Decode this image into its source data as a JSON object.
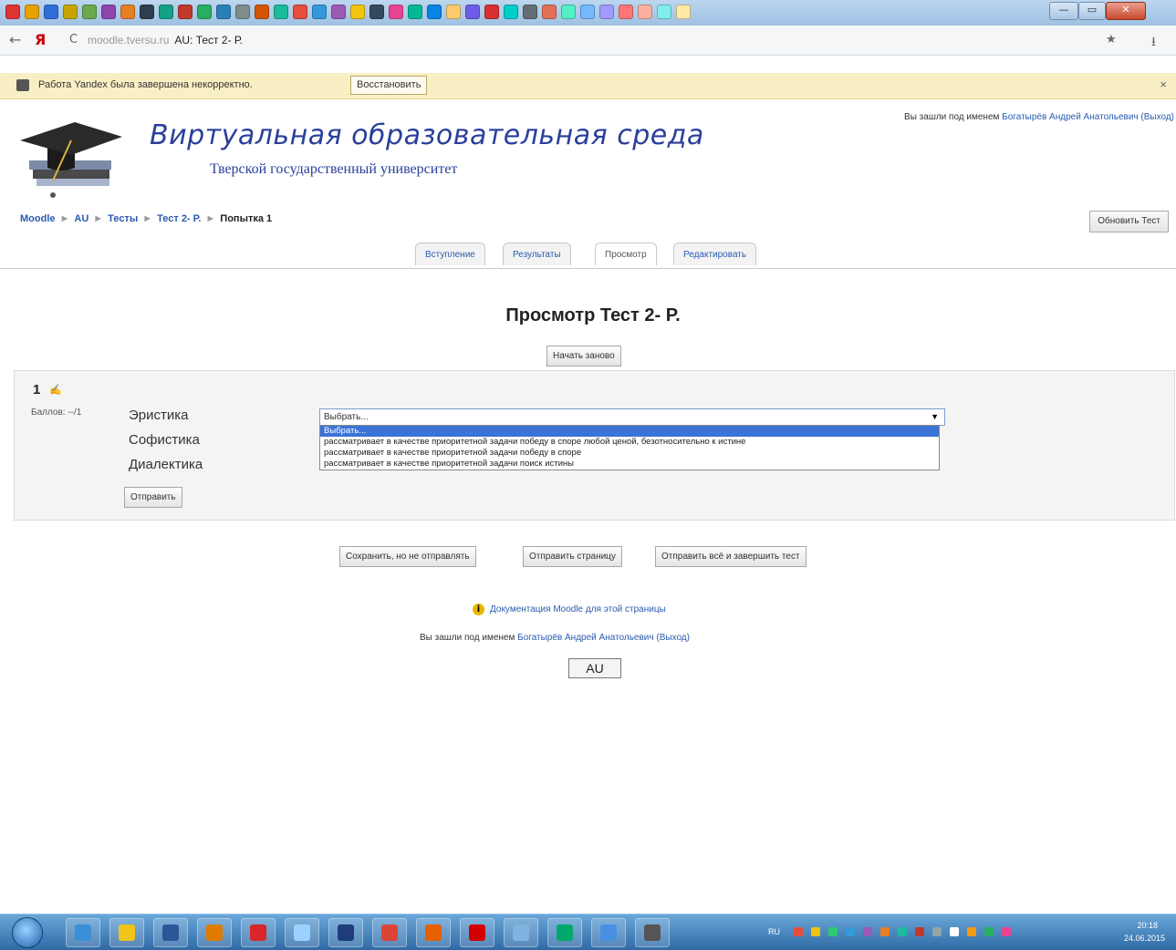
{
  "browser": {
    "url_host": "moodle.tversu.ru",
    "page_title": "AU: Тест 2- Р.",
    "notification": "Работа Yandex была завершена некорректно.",
    "restore_label": "Восстановить",
    "close_glyph": "×",
    "back_glyph": "←",
    "yandex_glyph": "Я",
    "reload_glyph": "C",
    "star_glyph": "★",
    "download_glyph": "⭳",
    "win_min": "—",
    "win_max": "▭",
    "win_close": "✕",
    "tab_icons": [
      "#d33",
      "#e8a000",
      "#2f6ed6",
      "#c9a400",
      "#6aa84f",
      "#8e44ad",
      "#e67e22",
      "#2c3e50",
      "#16a085",
      "#c0392b",
      "#27ae60",
      "#2980b9",
      "#7f8c8d",
      "#d35400",
      "#1abc9c",
      "#e74c3c",
      "#3498db",
      "#9b59b6",
      "#f1c40f",
      "#34495e",
      "#e84393",
      "#00b894",
      "#0984e3",
      "#fdcb6e",
      "#6c5ce7",
      "#d63031",
      "#00cec9",
      "#636e72",
      "#e17055",
      "#55efc4",
      "#74b9ff",
      "#a29bfe",
      "#ff7675",
      "#fab1a0",
      "#81ecec",
      "#ffeaa7"
    ]
  },
  "header": {
    "title": "Виртуальная образовательная среда",
    "subtitle": "Тверской государственный университет",
    "login_prefix": "Вы зашли под именем",
    "user_name": "Богатырёв Андрей Анатольевич",
    "logout": "(Выход)"
  },
  "breadcrumb": [
    "Moodle",
    "AU",
    "Тесты",
    "Тест 2- Р.",
    "Попытка 1"
  ],
  "breadcrumb_sep": "►",
  "update_button": "Обновить Тест",
  "tabs": [
    "Вступление",
    "Результаты",
    "Просмотр",
    "Редактировать"
  ],
  "page_heading": "Просмотр Тест 2- Р.",
  "restart_button": "Начать заново",
  "question": {
    "number": "1",
    "flag_glyph": "✍",
    "grade": "Баллов: --/1",
    "stems": [
      "Эристика",
      "Софистика",
      "Диалектика"
    ],
    "select_value": "Выбрать...",
    "select_arrow": "▼",
    "options": [
      "Выбрать...",
      "рассматривает в качестве приоритетной задачи победу в споре любой ценой, безотносительно к истине",
      "рассматривает в качестве приоритетной задачи победу в споре",
      "рассматривает в качестве приоритетной задачи поиск истины"
    ],
    "submit_button": "Отправить"
  },
  "actions": {
    "save": "Сохранить, но не отправлять",
    "submit_page": "Отправить страницу",
    "submit_all": "Отправить всё и завершить тест"
  },
  "footer": {
    "doc_link": "Документация Moodle для этой страницы",
    "info_glyph": "i",
    "login_prefix": "Вы зашли под именем",
    "user_name": "Богатырёв Андрей Анатольевич",
    "logout": "(Выход)",
    "home": "AU"
  },
  "taskbar": {
    "apps": [
      "#3b8fd6",
      "#f0c419",
      "#2b579a",
      "#e07b00",
      "#d8262a",
      "#9bd0ff",
      "#1f3d7a",
      "#db4437",
      "#e66000",
      "#d40000",
      "#7fb3e0",
      "#00a86b",
      "#4a90e2",
      "#555555"
    ],
    "lang": "RU",
    "time": "20:18",
    "date": "24.06.2015"
  }
}
